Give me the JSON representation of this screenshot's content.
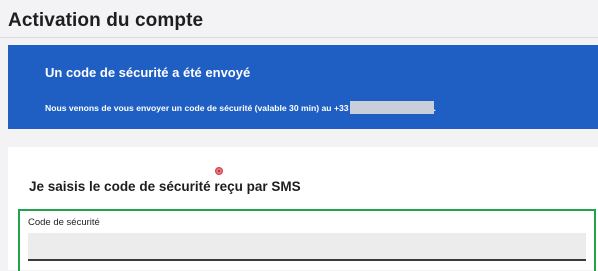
{
  "page": {
    "title": "Activation du compte"
  },
  "banner": {
    "title": "Un code de sécurité a été envoyé",
    "message": "Nous venons de vous envoyer un code de sécurité (valable 30 min) au",
    "phone_prefix": "+33",
    "trailing": "."
  },
  "form": {
    "heading": "Je saisis le code de sécurité reçu par SMS",
    "code_label": "Code de sécurité",
    "code_value": ""
  },
  "colors": {
    "banner_bg": "#1f5fc4",
    "focus_border": "#22a24a"
  }
}
